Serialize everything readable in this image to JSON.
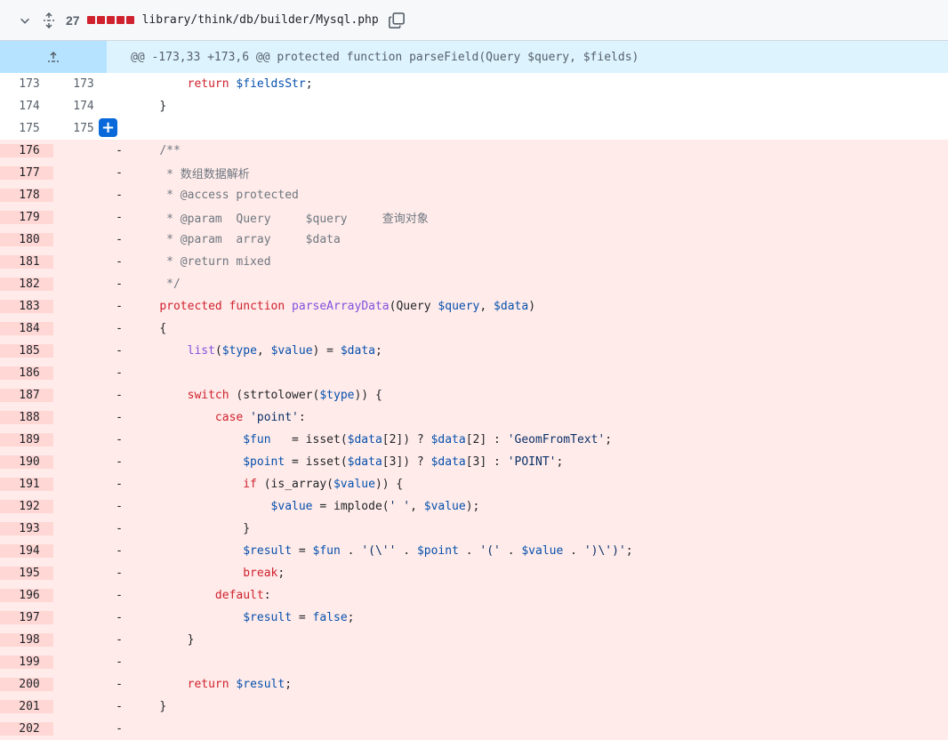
{
  "header": {
    "changes_count": "27",
    "file_path": "library/think/db/builder/Mysql.php",
    "deletion_color": "#cf222e"
  },
  "hunk": {
    "header": "@@ -173,33 +173,6 @@ protected function parseField(Query $query, $fields)"
  },
  "lines": {
    "l173": {
      "old": "173",
      "new": "173"
    },
    "l174": {
      "old": "174",
      "new": "174"
    },
    "l175": {
      "old": "175",
      "new": "175"
    },
    "l176": "176",
    "l177": "177",
    "l178": "178",
    "l179": "179",
    "l180": "180",
    "l181": "181",
    "l182": "182",
    "l183": "183",
    "l184": "184",
    "l185": "185",
    "l186": "186",
    "l187": "187",
    "l188": "188",
    "l189": "189",
    "l190": "190",
    "l191": "191",
    "l192": "192",
    "l193": "193",
    "l194": "194",
    "l195": "195",
    "l196": "196",
    "l197": "197",
    "l198": "198",
    "l199": "199",
    "l200": "200",
    "l201": "201",
    "l202": "202"
  },
  "deleted_marker": "-",
  "tokens": {
    "return": "return",
    "fieldsStr": "$fieldsStr",
    "semi": ";",
    "brace_close": "}",
    "brace_open": "{",
    "doc_open": "/**",
    "doc_desc": " * 数组数据解析",
    "doc_access": " * @access protected",
    "doc_param1": " * @param  Query     $query     查询对象",
    "doc_param2": " * @param  array     $data",
    "doc_return": " * @return mixed",
    "doc_close": " */",
    "protected": "protected",
    "function": "function",
    "parseArrayData": "parseArrayData",
    "query_t": "(Query ",
    "query_v": "$query",
    "comma": ", ",
    "data_v": "$data",
    "paren_close": ")",
    "list": "list",
    "paren_open": "(",
    "type_v": "$type",
    "value_v": "$value",
    "assign_close": ") = ",
    "switch": "switch",
    "strtolower_open": " (strtolower(",
    "switch_close": ")) {",
    "case": "case",
    "point_str": "'point'",
    "colon": ":",
    "fun_v": "$fun",
    "fun_assign": "   = isset(",
    "idx2": "[2]) ? ",
    "idx2b": "[2] : ",
    "geom_str": "'GeomFromText'",
    "point_v": "$point",
    "point_assign": " = isset(",
    "idx3": "[3]) ? ",
    "idx3b": "[3] : ",
    "POINT_str": "'POINT'",
    "if": "if",
    "is_array_open": " (is_array(",
    "if_close": ")) {",
    "value_assign": " = implode(",
    "space_str": "' '",
    "close_semi": ");",
    "result_v": "$result",
    "eq": " = ",
    "dot": " . ",
    "paren_str": "'(\\''",
    "open_str": "'('",
    "close_str": "')\\')'",
    "break": "break",
    "default": "default",
    "false": "false"
  }
}
